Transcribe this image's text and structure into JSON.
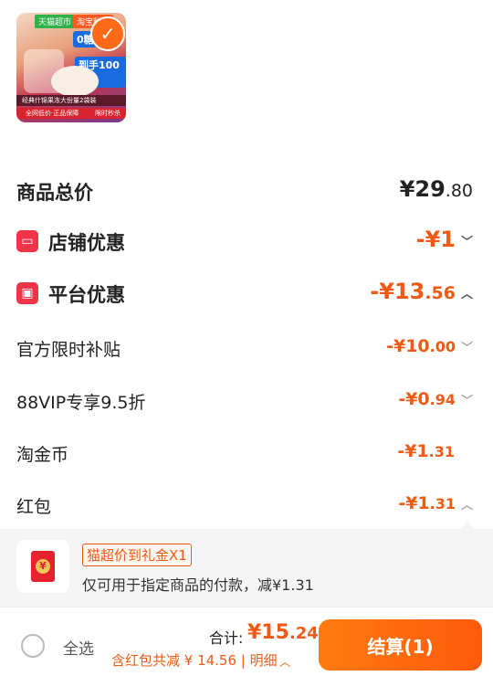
{
  "product": {
    "thumb_tag_1": "天猫超市",
    "thumb_tag_2": "淘宝秒杀",
    "thumb_promo_1": "0糖",
    "thumb_promo_2": "到手100杯",
    "thumb_strip_1": "经典什锦果冻大份量2袋装",
    "thumb_strip_2": "全网低价·正品保障",
    "thumb_strip_2_right": "限时秒杀",
    "selected": true
  },
  "summary": {
    "total_label": "商品总价",
    "total_value_main": "¥29",
    "total_value_decimal": ".80",
    "store_discount_label": "店铺优惠",
    "store_discount_value": "-¥1",
    "platform_discount_label": "平台优惠",
    "platform_discount_value_main": "-¥13",
    "platform_discount_value_decimal": ".56",
    "items": [
      {
        "label": "官方限时补贴",
        "value_main": "-¥10",
        "value_decimal": ".00",
        "chevron": "down"
      },
      {
        "label": "88VIP专享9.5折",
        "value_main": "-¥0",
        "value_decimal": ".94",
        "chevron": "down"
      },
      {
        "label": "淘金币",
        "value_main": "-¥1",
        "value_decimal": ".31",
        "chevron": ""
      },
      {
        "label": "红包",
        "value_main": "-¥1",
        "value_decimal": ".31",
        "chevron": "up"
      }
    ]
  },
  "gift": {
    "chip": "猫超价到礼金X1",
    "desc": "仅可用于指定商品的付款，减¥1.31"
  },
  "bottom": {
    "select_all": "全选",
    "total_label": "合计:",
    "total_main": "¥15",
    "total_decimal": ".24",
    "saving": "含红包共减 ¥ 14.56 | 明细",
    "checkout": "结算(1)"
  },
  "colors": {
    "accent": "#f05a14",
    "checkout": "#ff6a10",
    "icon_red": "#f0344a"
  }
}
